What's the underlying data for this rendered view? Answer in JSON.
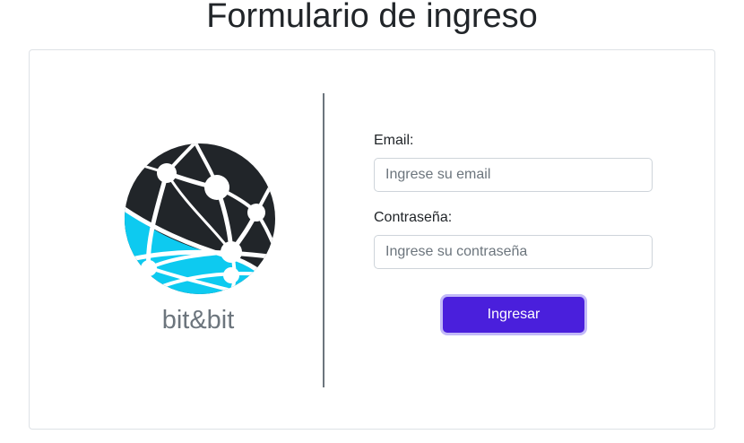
{
  "page": {
    "title": "Formulario de ingreso"
  },
  "brand": {
    "name": "bit&bit",
    "logo_icon": "globe-network-icon",
    "colors": {
      "dark": "#212529",
      "cyan": "#0dcaf0",
      "text": "#6c757d"
    }
  },
  "form": {
    "email_label": "Email:",
    "email_placeholder": "Ingrese su email",
    "email_value": "",
    "password_label": "Contraseña:",
    "password_placeholder": "Ingrese su contraseña",
    "password_value": "",
    "submit_label": "Ingresar",
    "submit_color": "#4a1fdc"
  }
}
